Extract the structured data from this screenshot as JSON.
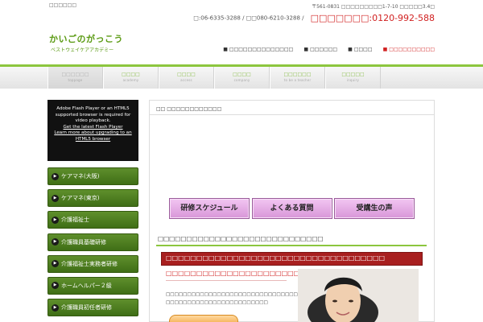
{
  "topbar": {
    "tagline": "□□□□□□",
    "address": "〒561-0831 □□□□□□□□□1-7-10 □□□□□3.4□"
  },
  "header": {
    "logo_main": "かいごのがっこう",
    "logo_sub": "ベストウェイケアアカデミー",
    "phone_1": "□:06-6335-3288 / □□080-6210-3288 /",
    "phone_free": "□□□□□□□:0120-992-588",
    "links": [
      {
        "label": "□□□□□□□□□□□□□□"
      },
      {
        "label": "□□□□□□"
      },
      {
        "label": "□□□□"
      },
      {
        "label": "□□□□□□□□□□"
      }
    ]
  },
  "nav": {
    "items": [
      {
        "jp": "□□□□□□",
        "en": "toppage"
      },
      {
        "jp": "□□□□",
        "en": "academy"
      },
      {
        "jp": "□□□□",
        "en": "access"
      },
      {
        "jp": "□□□□",
        "en": "company"
      },
      {
        "jp": "□□□□□□",
        "en": "to be a teacher"
      },
      {
        "jp": "□□□□□",
        "en": "inquiry"
      }
    ]
  },
  "sidebar": {
    "flash": {
      "line1": "Adobe Flash Player or an HTML5",
      "line2": "supported browser is required for",
      "line3": "video playback.",
      "link1": "Get the latest Flash Player",
      "link2": "Learn more about upgrading to an",
      "link3": "HTML5 browser"
    },
    "items": [
      {
        "label": "ケアマネ(大阪)"
      },
      {
        "label": "ケアマネ(東京)"
      },
      {
        "label": "介護福祉士"
      },
      {
        "label": "介護職員基礎研修"
      },
      {
        "label": "介護福祉士実務者研修"
      },
      {
        "label": "ホームヘルパー２級"
      },
      {
        "label": "介護職員初任者研修"
      }
    ]
  },
  "main": {
    "title": "□□ □□□□□□□□□□□□",
    "buttons": [
      {
        "label": "研修スケジュール"
      },
      {
        "label": "よくある質問"
      },
      {
        "label": "受講生の声"
      }
    ],
    "section_heading": "□□□□□□□□□□□□□□□□□□□□□□□□□□□□□",
    "red_banner": "□□□□□□□□□□□□□□□□□□□□□□□□□□□□□□□□□□□□",
    "red_sub": "□□□□□□□□□□□□□□□□□□□□□□□□□□□",
    "body_line1": "□□□□□□□□□□□□□□□□□□□□□□□□□□□□□□□□□□□□□□",
    "body_line2": "□□□□□□□□□□□□□□□□□□□□□□□□"
  },
  "colors": {
    "brand_green": "#8cc63e",
    "logo_green": "#5a9a12",
    "accent_red": "#d12121",
    "banner_red": "#a81f1f",
    "sidebar_green": "#4e7f22",
    "button_pink": "#e6b0e6"
  }
}
